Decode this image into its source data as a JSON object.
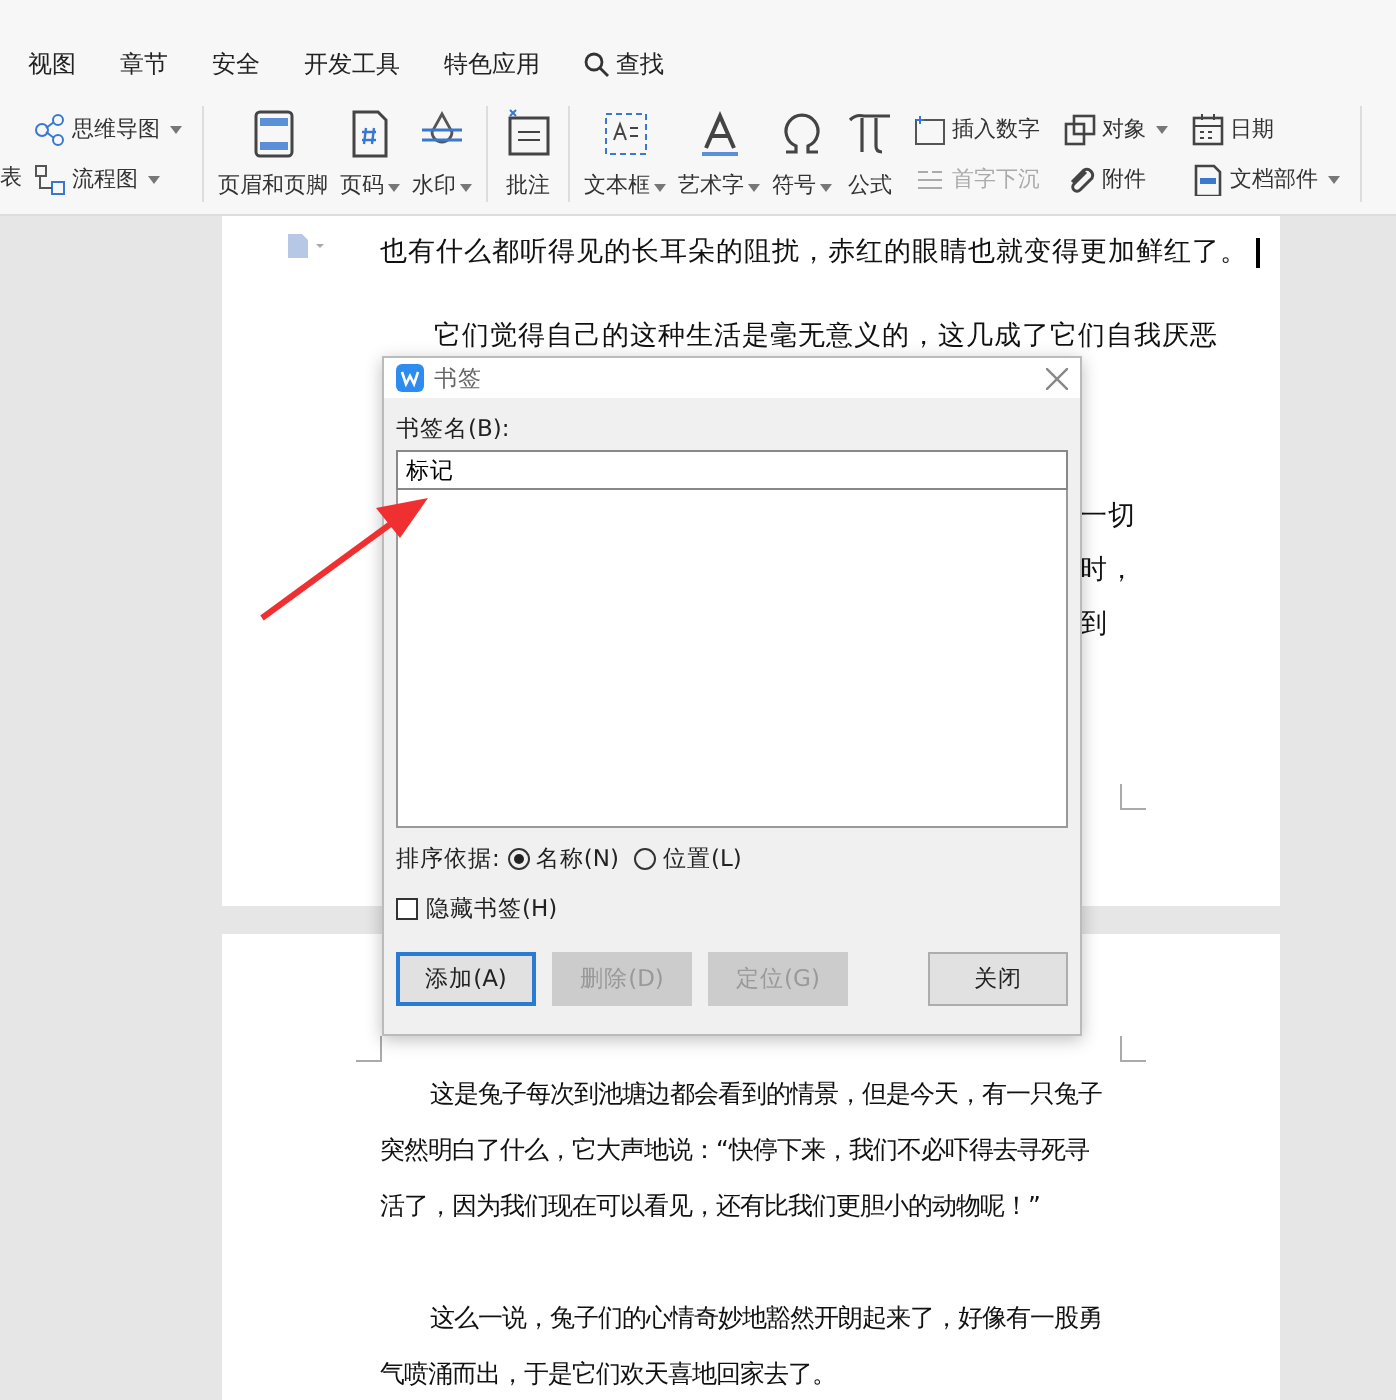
{
  "tabs": [
    {
      "label": "视图",
      "kind": "text"
    },
    {
      "label": "章节",
      "kind": "text"
    },
    {
      "label": "安全",
      "kind": "text"
    },
    {
      "label": "开发工具",
      "kind": "text"
    },
    {
      "label": "特色应用",
      "kind": "text"
    },
    {
      "label": "查找",
      "kind": "search"
    }
  ],
  "toolbar": {
    "left_cut": "表",
    "small_left": [
      {
        "label": "思维导图",
        "dropdown": true
      },
      {
        "label": "流程图",
        "dropdown": true
      }
    ],
    "large": [
      {
        "label": "页眉和页脚",
        "dropdown": false
      },
      {
        "label": "页码",
        "dropdown": true
      },
      {
        "label": "水印",
        "dropdown": true
      },
      {
        "label": "批注",
        "dropdown": false
      },
      {
        "label": "文本框",
        "dropdown": true
      },
      {
        "label": "艺术字",
        "dropdown": true
      },
      {
        "label": "符号",
        "dropdown": true
      },
      {
        "label": "公式",
        "dropdown": false
      }
    ],
    "small_right": [
      {
        "label": "插入数字",
        "dropdown": false,
        "disabled": false
      },
      {
        "label": "首字下沉",
        "dropdown": false,
        "disabled": true
      },
      {
        "label": "对象",
        "dropdown": true,
        "disabled": false
      },
      {
        "label": "附件",
        "dropdown": false,
        "disabled": false
      },
      {
        "label": "日期",
        "dropdown": false,
        "disabled": false
      },
      {
        "label": "文档部件",
        "dropdown": true,
        "disabled": false
      }
    ]
  },
  "page1": {
    "lines": [
      "也有什么都听得见的长耳朵的阻扰，赤红的眼睛也就变得更加鲜红了。",
      "它们觉得自己的这种生活是毫无意义的，这几成了它们自我厌恶"
    ],
    "fragments": [
      "一切",
      "时，",
      "到"
    ]
  },
  "page2": {
    "paragraphs": [
      "这是兔子每次到池塘边都会看到的情景，但是今天，有一只兔子突然明白了什么，它大声地说：“快停下来，我们不必吓得去寻死寻活了，因为我们现在可以看见，还有比我们更胆小的动物呢！”",
      "这么一说，兔子们的心情奇妙地豁然开朗起来了，好像有一股勇气喷涌而出，于是它们欢天喜地回家去了。"
    ]
  },
  "dialog": {
    "title": "书签",
    "name_label": "书签名(B):",
    "name_value": "标记",
    "sort_label": "排序依据:",
    "sort_options": [
      {
        "label": "名称(N)",
        "selected": true
      },
      {
        "label": "位置(L)",
        "selected": false
      }
    ],
    "hide": {
      "label": "隐藏书签(H)",
      "checked": false
    },
    "buttons": [
      {
        "label": "添加(A)",
        "default": true,
        "disabled": false
      },
      {
        "label": "删除(D)",
        "default": false,
        "disabled": true
      },
      {
        "label": "定位(G)",
        "default": false,
        "disabled": true
      },
      {
        "label": "关闭",
        "default": false,
        "disabled": false
      }
    ]
  }
}
